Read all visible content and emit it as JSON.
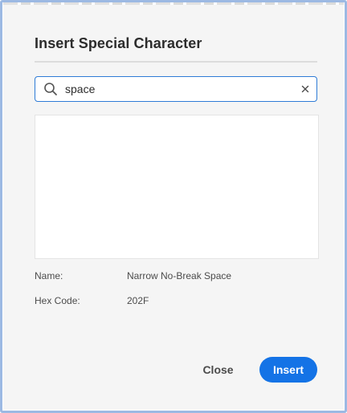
{
  "dialog": {
    "title": "Insert Special Character"
  },
  "search": {
    "value": "space",
    "search_icon": "search-icon",
    "clear_icon": "close-icon"
  },
  "details": {
    "name_label": "Name:",
    "name_value": "Narrow No-Break Space",
    "hex_label": "Hex Code:",
    "hex_value": "202F"
  },
  "actions": {
    "close_label": "Close",
    "insert_label": "Insert"
  },
  "colors": {
    "accent": "#1473e6",
    "focus_border": "#2e7bd6",
    "dialog_background": "#f5f5f5",
    "window_border": "#9cb9e3"
  }
}
